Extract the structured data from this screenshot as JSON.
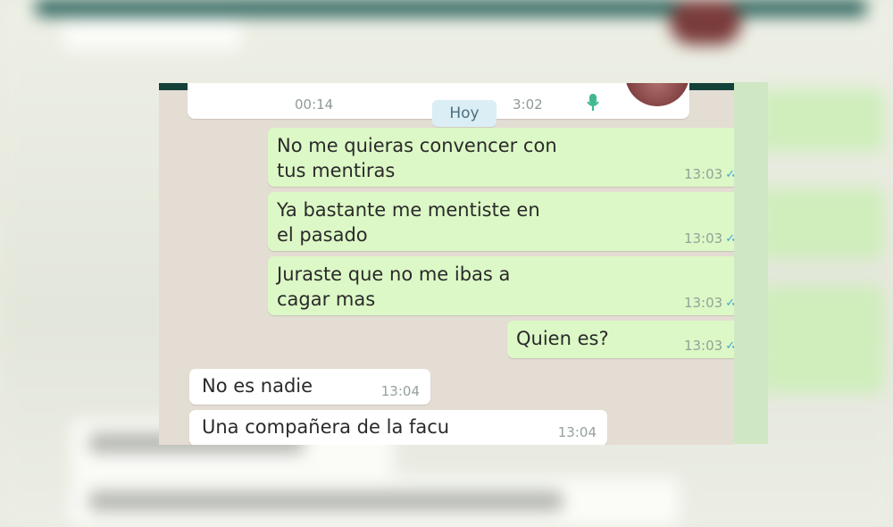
{
  "chat": {
    "audio": {
      "duration": "00:14",
      "sent_time": "3:02"
    },
    "date_divider": "Hoy",
    "messages": [
      {
        "dir": "out",
        "text": "No me quieras convencer con\ntus mentiras",
        "time": "13:03"
      },
      {
        "dir": "out",
        "text": "Ya bastante me mentiste en\nel pasado",
        "time": "13:03"
      },
      {
        "dir": "out",
        "text": "Juraste que no me ibas a\ncagar mas",
        "time": "13:03"
      },
      {
        "dir": "out",
        "text": "Quien es?",
        "time": "13:03"
      },
      {
        "dir": "in",
        "text": "No es nadie",
        "time": "13:04"
      },
      {
        "dir": "in",
        "text": "Una compañera de la facu",
        "time": "13:04"
      }
    ]
  },
  "colors": {
    "outgoing_bubble": "#dcf8c6",
    "incoming_bubble": "#ffffff",
    "header": "#14423b",
    "read_ticks": "#45a8d8"
  },
  "icons": [
    "mic-icon",
    "double-check-icon"
  ]
}
